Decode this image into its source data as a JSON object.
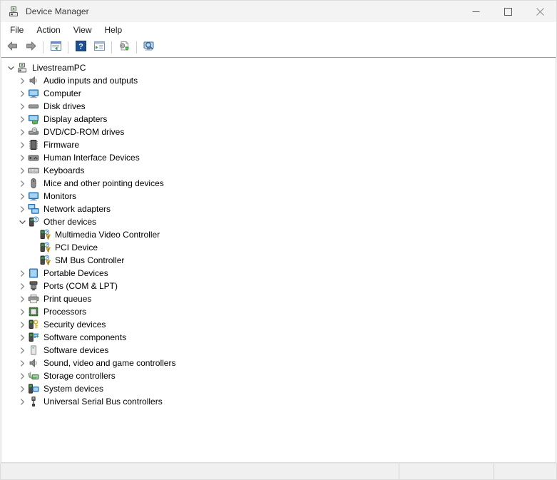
{
  "window": {
    "title": "Device Manager",
    "icon": "device-manager-icon"
  },
  "window_controls": {
    "minimize": "minimize-icon",
    "maximize": "maximize-icon",
    "close": "close-icon"
  },
  "menubar": {
    "items": [
      {
        "label": "File"
      },
      {
        "label": "Action"
      },
      {
        "label": "View"
      },
      {
        "label": "Help"
      }
    ]
  },
  "toolbar": {
    "buttons": [
      {
        "name": "back-button",
        "icon": "left-arrow-icon"
      },
      {
        "name": "forward-button",
        "icon": "right-arrow-icon"
      },
      {
        "name": "separator-1",
        "icon": "separator"
      },
      {
        "name": "show-hide-console-tree-button",
        "icon": "console-tree-icon"
      },
      {
        "name": "separator-2",
        "icon": "separator"
      },
      {
        "name": "help-button",
        "icon": "question-mark-icon"
      },
      {
        "name": "properties-button",
        "icon": "properties-icon"
      },
      {
        "name": "separator-3",
        "icon": "separator"
      },
      {
        "name": "update-driver-button",
        "icon": "update-driver-icon"
      },
      {
        "name": "separator-4",
        "icon": "separator"
      },
      {
        "name": "scan-for-hardware-changes-button",
        "icon": "scan-hardware-icon"
      }
    ]
  },
  "tree": {
    "nodes": [
      {
        "label": "LivestreamPC",
        "depth": 0,
        "expander": "expanded",
        "icon": "computer-root-icon"
      },
      {
        "label": "Audio inputs and outputs",
        "depth": 1,
        "expander": "collapsed",
        "icon": "speaker-icon"
      },
      {
        "label": "Computer",
        "depth": 1,
        "expander": "collapsed",
        "icon": "monitor-icon"
      },
      {
        "label": "Disk drives",
        "depth": 1,
        "expander": "collapsed",
        "icon": "disk-drive-icon"
      },
      {
        "label": "Display adapters",
        "depth": 1,
        "expander": "collapsed",
        "icon": "display-adapter-icon"
      },
      {
        "label": "DVD/CD-ROM drives",
        "depth": 1,
        "expander": "collapsed",
        "icon": "dvd-drive-icon"
      },
      {
        "label": "Firmware",
        "depth": 1,
        "expander": "collapsed",
        "icon": "firmware-chip-icon"
      },
      {
        "label": "Human Interface Devices",
        "depth": 1,
        "expander": "collapsed",
        "icon": "hid-icon"
      },
      {
        "label": "Keyboards",
        "depth": 1,
        "expander": "collapsed",
        "icon": "keyboard-icon"
      },
      {
        "label": "Mice and other pointing devices",
        "depth": 1,
        "expander": "collapsed",
        "icon": "mouse-icon"
      },
      {
        "label": "Monitors",
        "depth": 1,
        "expander": "collapsed",
        "icon": "monitor-icon"
      },
      {
        "label": "Network adapters",
        "depth": 1,
        "expander": "collapsed",
        "icon": "network-adapter-icon"
      },
      {
        "label": "Other devices",
        "depth": 1,
        "expander": "expanded",
        "icon": "unknown-device-icon"
      },
      {
        "label": "Multimedia Video Controller",
        "depth": 2,
        "expander": "none",
        "icon": "unknown-device-warning-icon"
      },
      {
        "label": "PCI Device",
        "depth": 2,
        "expander": "none",
        "icon": "unknown-device-warning-icon"
      },
      {
        "label": "SM Bus Controller",
        "depth": 2,
        "expander": "none",
        "icon": "unknown-device-warning-icon"
      },
      {
        "label": "Portable Devices",
        "depth": 1,
        "expander": "collapsed",
        "icon": "portable-device-icon"
      },
      {
        "label": "Ports (COM & LPT)",
        "depth": 1,
        "expander": "collapsed",
        "icon": "port-icon"
      },
      {
        "label": "Print queues",
        "depth": 1,
        "expander": "collapsed",
        "icon": "printer-icon"
      },
      {
        "label": "Processors",
        "depth": 1,
        "expander": "collapsed",
        "icon": "processor-icon"
      },
      {
        "label": "Security devices",
        "depth": 1,
        "expander": "collapsed",
        "icon": "security-key-icon"
      },
      {
        "label": "Software components",
        "depth": 1,
        "expander": "collapsed",
        "icon": "software-component-icon"
      },
      {
        "label": "Software devices",
        "depth": 1,
        "expander": "collapsed",
        "icon": "software-device-icon"
      },
      {
        "label": "Sound, video and game controllers",
        "depth": 1,
        "expander": "collapsed",
        "icon": "speaker-icon"
      },
      {
        "label": "Storage controllers",
        "depth": 1,
        "expander": "collapsed",
        "icon": "storage-controller-icon"
      },
      {
        "label": "System devices",
        "depth": 1,
        "expander": "collapsed",
        "icon": "system-device-icon"
      },
      {
        "label": "Universal Serial Bus controllers",
        "depth": 1,
        "expander": "collapsed",
        "icon": "usb-icon"
      }
    ]
  },
  "statusbar": {
    "panes": [
      "",
      "",
      ""
    ]
  },
  "colors": {
    "accent_blue": "#3f8fd0",
    "warning_yellow": "#f5c13d",
    "window_bg": "#f3f3f3",
    "content_bg": "#ffffff",
    "text": "#000000"
  }
}
